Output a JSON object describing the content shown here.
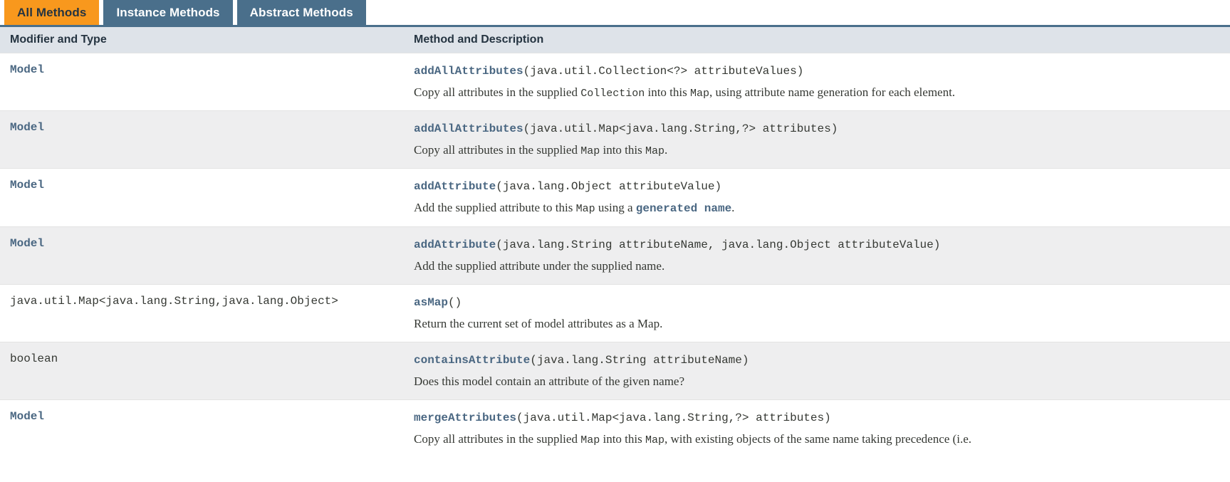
{
  "tabs": [
    {
      "label": "All Methods",
      "state": "active",
      "name": "tab-all-methods"
    },
    {
      "label": "Instance Methods",
      "state": "inactive",
      "name": "tab-instance-methods"
    },
    {
      "label": "Abstract Methods",
      "state": "inactive",
      "name": "tab-abstract-methods"
    }
  ],
  "colors": {
    "tab_active_bg": "#f8981d",
    "tab_active_text": "#253441",
    "tab_inactive_bg": "#4a6f8b",
    "tab_inactive_text": "#ffffff",
    "header_bg": "#dee3e9",
    "row_alt_bg": "#eeeeef",
    "link": "#4a6782",
    "text": "#353833"
  },
  "table": {
    "headers": {
      "modifier_and_type": "Modifier and Type",
      "method_and_description": "Method and Description"
    },
    "rows": [
      {
        "type": "Model",
        "type_is_link": true,
        "method_name": "addAllAttributes",
        "method_params": "(java.util.Collection<?> attributeValues)",
        "desc_parts": [
          {
            "text": "Copy all attributes in the supplied ",
            "style": "serif"
          },
          {
            "text": "Collection",
            "style": "mono"
          },
          {
            "text": " into this ",
            "style": "serif"
          },
          {
            "text": "Map",
            "style": "mono"
          },
          {
            "text": ", using attribute name generation for each element.",
            "style": "serif"
          }
        ]
      },
      {
        "type": "Model",
        "type_is_link": true,
        "method_name": "addAllAttributes",
        "method_params": "(java.util.Map<java.lang.String,?> attributes)",
        "desc_parts": [
          {
            "text": "Copy all attributes in the supplied ",
            "style": "serif"
          },
          {
            "text": "Map",
            "style": "mono"
          },
          {
            "text": " into this ",
            "style": "serif"
          },
          {
            "text": "Map",
            "style": "mono"
          },
          {
            "text": ".",
            "style": "serif"
          }
        ]
      },
      {
        "type": "Model",
        "type_is_link": true,
        "method_name": "addAttribute",
        "method_params": "(java.lang.Object attributeValue)",
        "desc_parts": [
          {
            "text": "Add the supplied attribute to this ",
            "style": "serif"
          },
          {
            "text": "Map",
            "style": "mono"
          },
          {
            "text": " using a ",
            "style": "serif"
          },
          {
            "text": "generated name",
            "style": "link"
          },
          {
            "text": ".",
            "style": "serif"
          }
        ]
      },
      {
        "type": "Model",
        "type_is_link": true,
        "method_name": "addAttribute",
        "method_params": "(java.lang.String attributeName, java.lang.Object attributeValue)",
        "desc_parts": [
          {
            "text": "Add the supplied attribute under the supplied name.",
            "style": "serif"
          }
        ]
      },
      {
        "type": "java.util.Map<java.lang.String,java.lang.Object>",
        "type_is_link": false,
        "method_name": "asMap",
        "method_params": "()",
        "desc_parts": [
          {
            "text": "Return the current set of model attributes as a Map.",
            "style": "serif"
          }
        ]
      },
      {
        "type": "boolean",
        "type_is_link": false,
        "method_name": "containsAttribute",
        "method_params": "(java.lang.String attributeName)",
        "desc_parts": [
          {
            "text": "Does this model contain an attribute of the given name?",
            "style": "serif"
          }
        ]
      },
      {
        "type": "Model",
        "type_is_link": true,
        "method_name": "mergeAttributes",
        "method_params": "(java.util.Map<java.lang.String,?> attributes)",
        "desc_parts": [
          {
            "text": "Copy all attributes in the supplied ",
            "style": "serif"
          },
          {
            "text": "Map",
            "style": "mono"
          },
          {
            "text": " into this ",
            "style": "serif"
          },
          {
            "text": "Map",
            "style": "mono"
          },
          {
            "text": ", with existing objects of the same name taking precedence (i.e.",
            "style": "serif"
          }
        ]
      }
    ]
  }
}
